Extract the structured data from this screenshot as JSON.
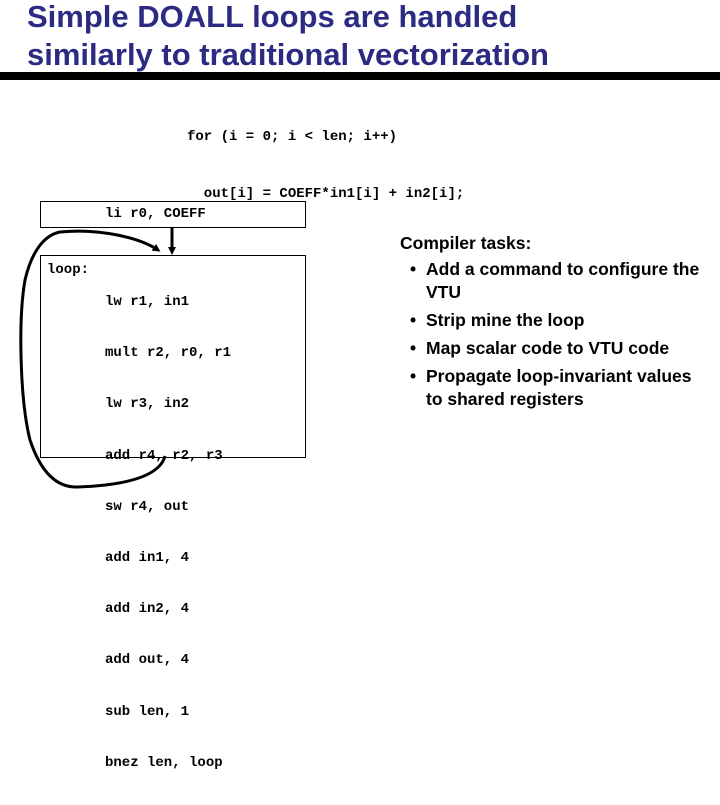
{
  "slide": {
    "title_lines": [
      "Simple DOALL loops are handled",
      "similarly to traditional vectorization"
    ]
  },
  "source_code": {
    "lines": [
      "for (i = 0; i < len; i++)",
      "  out[i] = COEFF*in1[i] + in2[i];"
    ]
  },
  "preheader_block": {
    "instruction": "li r0, COEFF"
  },
  "loop_block": {
    "label": "loop:",
    "instructions": [
      "lw r1, in1",
      "mult r2, r0, r1",
      "lw r3, in2",
      "add r4, r2, r3",
      "sw r4, out",
      "add in1, 4",
      "add in2, 4",
      "add out, 4",
      "sub len, 1",
      "bnez len, loop"
    ]
  },
  "compiler_tasks": {
    "heading": "Compiler tasks:",
    "bullet_glyph": "•",
    "items": [
      "Add a command to configure the VTU",
      "Strip mine the loop",
      "Map scalar code to VTU code",
      "Propagate loop-invariant values to shared registers"
    ]
  },
  "colors": {
    "title": "#2b2b82",
    "rule": "#000000",
    "text": "#000000"
  }
}
